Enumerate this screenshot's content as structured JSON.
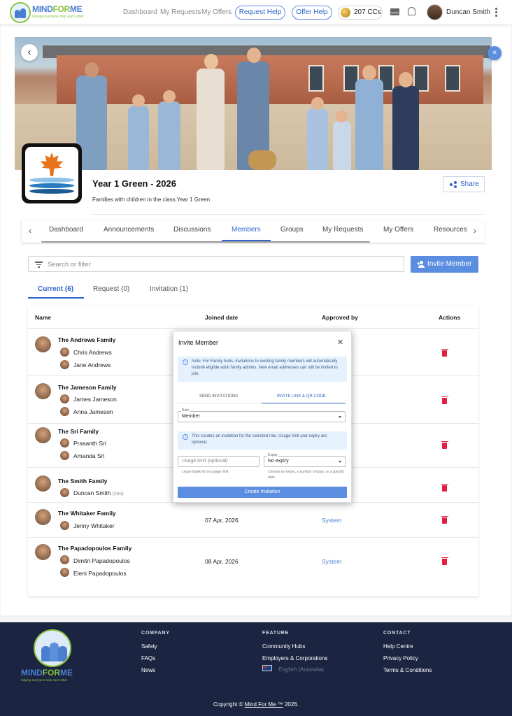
{
  "brand": {
    "name_part1": "MIND",
    "name_part2": "FOR",
    "name_part3": "ME",
    "tagline": "helping everyone help each other"
  },
  "topnav": {
    "dashboard": "Dashboard",
    "my_requests": "My Requests",
    "my_offers": "My Offers",
    "request_help": "Request Help",
    "offer_help": "Offer Help",
    "ccs": "207 CCs",
    "user_name": "Duncan Smith"
  },
  "hub": {
    "title": "Year 1 Green - 2026",
    "description": "Families with children in the class Year 1 Green",
    "share_label": "Share"
  },
  "tabs": [
    "Dashboard",
    "Announcements",
    "Discussions",
    "Members",
    "Groups",
    "My Requests",
    "My Offers",
    "Resources"
  ],
  "active_tab": "Members",
  "search": {
    "placeholder": "Search or filter"
  },
  "invite_button": "Invite Member",
  "subtabs": {
    "current": "Current (6)",
    "request": "Request (0)",
    "invitation": "Invitation (1)"
  },
  "table": {
    "headers": {
      "name": "Name",
      "joined": "Joined date",
      "approved": "Approved by",
      "actions": "Actions"
    },
    "rows": [
      {
        "family": "The Andrews Family",
        "members": [
          "Chris Andrews",
          "Jane Andrews"
        ],
        "joined": "",
        "approved": ""
      },
      {
        "family": "The Jameson Family",
        "members": [
          "James Jameson",
          "Anna Jameson"
        ],
        "joined": "",
        "approved": ""
      },
      {
        "family": "The Sri Family",
        "members": [
          "Prasanth Sri",
          "Amanda Sri"
        ],
        "joined": "",
        "approved": ""
      },
      {
        "family": "The Smith Family",
        "members": [
          "Duncan Smith"
        ],
        "you_label": "(you)",
        "joined": "",
        "approved": ""
      },
      {
        "family": "The Whitaker Family",
        "members": [
          "Jenny Whitaker"
        ],
        "joined": "07 Apr, 2026",
        "approved": "System"
      },
      {
        "family": "The Papadopoulos Family",
        "members": [
          "Dimitri Papadopoulos",
          "Eleni Papadopoulos"
        ],
        "joined": "08 Apr, 2026",
        "approved": "System"
      }
    ]
  },
  "modal": {
    "title": "Invite Member",
    "note": "Note: For Family hubs, invitations to existing family members will automatically include eligible adult family admins. New email addresses can still be invited to join.",
    "tab_send": "SEND INVITATIONS",
    "tab_link": "INVITE LINK & QR CODE",
    "role_label": "Role",
    "role_value": "Member",
    "info": "This creates an invitation for the selected role. Usage limit and expiry are optional.",
    "usage_placeholder": "Usage limit (optional)",
    "usage_hint": "Leave blank for no usage limit",
    "expiry_label": "Expiry",
    "expiry_value": "No expiry",
    "expiry_hint": "Choose no expiry, a number of days, or a specific date",
    "create_button": "Create Invitation"
  },
  "footer": {
    "company": {
      "heading": "COMPANY",
      "links": [
        "Safety",
        "FAQs",
        "News"
      ]
    },
    "feature": {
      "heading": "FEATURE",
      "links": [
        "Community Hubs",
        "Employers & Corporations"
      ],
      "language": "English (Australia)"
    },
    "contact": {
      "heading": "CONTACT",
      "links": [
        "Help Centre",
        "Privacy Policy",
        "Terms & Conditions"
      ]
    },
    "copyright_prefix": "Copyright ©",
    "copyright_link": "Mind For Me ™",
    "copyright_suffix": "2026."
  },
  "colors": {
    "accent": "#5b8de0",
    "brand_green": "#8ac43f",
    "delete_red": "#e0203e",
    "footer_bg": "#1b2541"
  },
  "icons": [
    "back-arrow-icon",
    "collapse-icon",
    "share-icon",
    "filter-icon",
    "person-add-icon",
    "trash-icon",
    "mail-icon",
    "bell-icon",
    "info-icon",
    "close-icon",
    "dropdown-caret-icon",
    "chevron-left-icon",
    "chevron-right-icon",
    "coin-icon",
    "kebab-icon",
    "australia-flag-icon"
  ]
}
